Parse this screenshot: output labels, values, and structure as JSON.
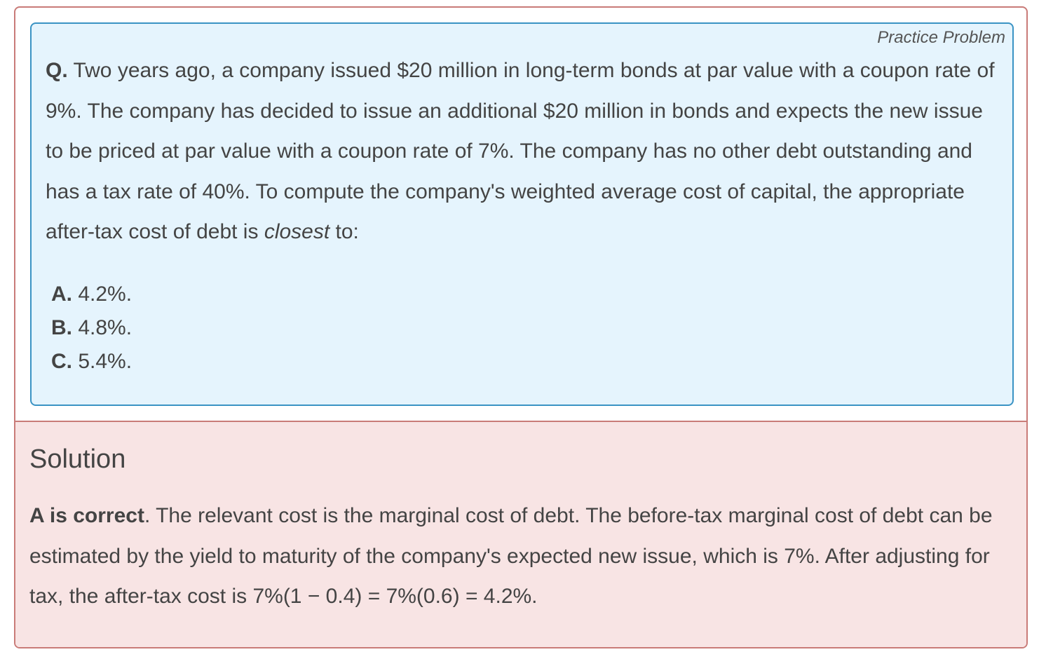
{
  "question": {
    "badge": "Practice Problem",
    "prefix": "Q.",
    "text_before_emphasis": " Two years ago, a company issued $20 million in long-term bonds at par value with a coupon rate of 9%. The company has decided to issue an additional $20 million in bonds and expects the new issue to be priced at par value with a coupon rate of 7%. The company has no other debt outstanding and has a tax rate of 40%. To compute the company's weighted average cost of capital, the appropriate after-tax cost of debt is ",
    "emphasis": "closest",
    "text_after_emphasis": " to:",
    "options": [
      {
        "letter": "A.",
        "text": " 4.2%."
      },
      {
        "letter": "B.",
        "text": " 4.8%."
      },
      {
        "letter": "C.",
        "text": " 5.4%."
      }
    ]
  },
  "solution": {
    "title": "Solution",
    "correct_label": "A is correct",
    "body": ". The relevant cost is the marginal cost of debt. The before-tax marginal cost of debt can be estimated by the yield to maturity of the company's expected new issue, which is 7%. After adjusting for tax, the after-tax cost is 7%(1 − 0.4) = 7%(0.6) = 4.2%."
  },
  "colors": {
    "card_border": "#c97b78",
    "question_border": "#3a93c4",
    "question_background": "#e5f4fd",
    "solution_background": "#f8e4e4",
    "text": "#444444"
  }
}
